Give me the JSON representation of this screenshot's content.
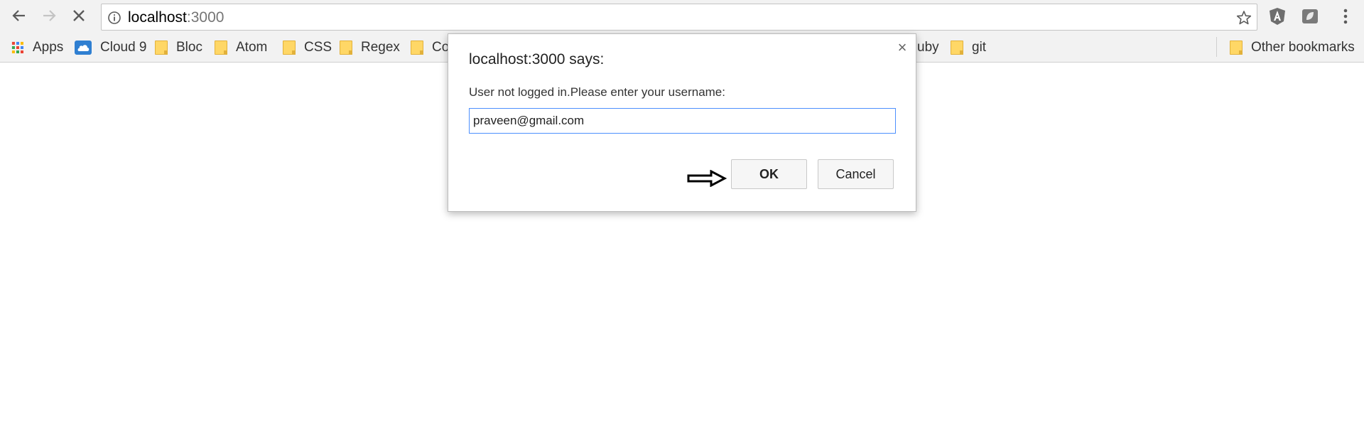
{
  "toolbar": {
    "url_host": "localhost",
    "url_port": ":3000"
  },
  "bookmarks": {
    "items": [
      {
        "label": "Apps",
        "icon": "apps-grid-icon"
      },
      {
        "label": "Cloud 9",
        "icon": "cloud9-icon"
      },
      {
        "label": "Bloc",
        "icon": "folder-icon"
      },
      {
        "label": "Atom",
        "icon": "folder-icon"
      },
      {
        "label": "CSS",
        "icon": "folder-icon"
      },
      {
        "label": "Regex",
        "icon": "folder-icon"
      },
      {
        "label": "Co",
        "icon": "folder-icon"
      },
      {
        "label": "uby",
        "icon": "folder-icon"
      },
      {
        "label": "git",
        "icon": "folder-icon"
      }
    ],
    "other_label": "Other bookmarks"
  },
  "dialog": {
    "title": "localhost:3000 says:",
    "message": "User not logged in.Please enter your username:",
    "input_value": "praveen@gmail.com",
    "ok_label": "OK",
    "cancel_label": "Cancel",
    "close_glyph": "×"
  },
  "colors": {
    "accent_focus": "#4d90fe",
    "folder": "#ffd766",
    "toolbar_bg": "#f2f2f2"
  }
}
